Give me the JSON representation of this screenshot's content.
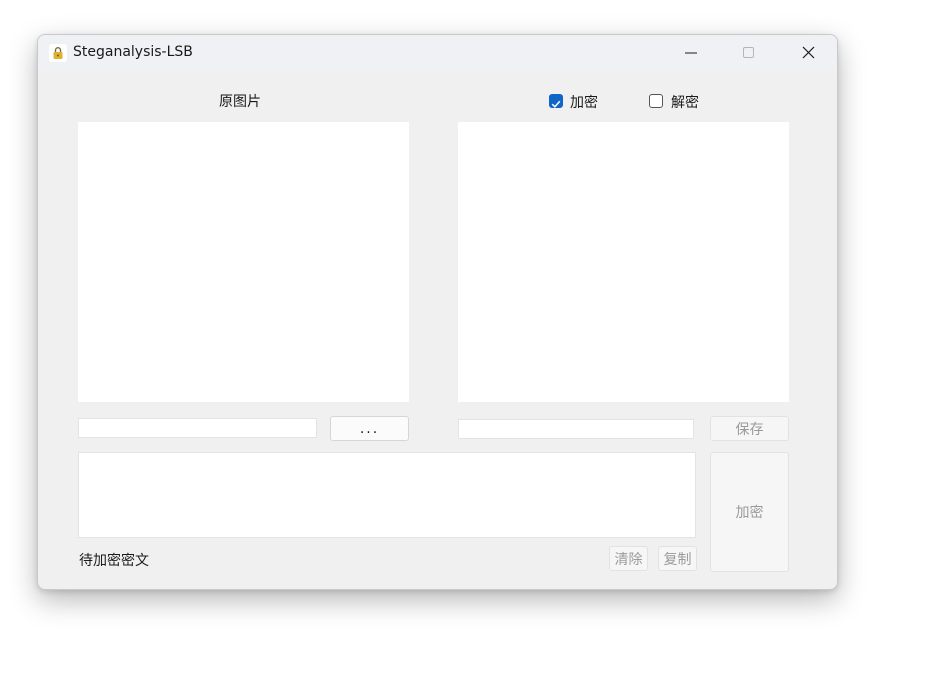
{
  "window": {
    "title": "Steganalysis-LSB",
    "icon": "lock-icon"
  },
  "controls": {
    "minimize_icon": "minimize-icon",
    "maximize_icon": "maximize-icon",
    "close_icon": "close-icon"
  },
  "left_panel": {
    "title": "原图片",
    "path_value": "",
    "browse_label": "..."
  },
  "mode": {
    "encrypt_label": "加密",
    "encrypt_checked": true,
    "decrypt_label": "解密",
    "decrypt_checked": false
  },
  "right_panel": {
    "path_value": "",
    "save_label": "保存"
  },
  "text_area": {
    "value": "",
    "caption": "待加密密文",
    "clear_label": "清除",
    "copy_label": "复制"
  },
  "action": {
    "label": "加密"
  },
  "colors": {
    "accent": "#0f66c7",
    "window_bg": "#f0f0f0",
    "titlebar_bg": "#eff1f4"
  }
}
